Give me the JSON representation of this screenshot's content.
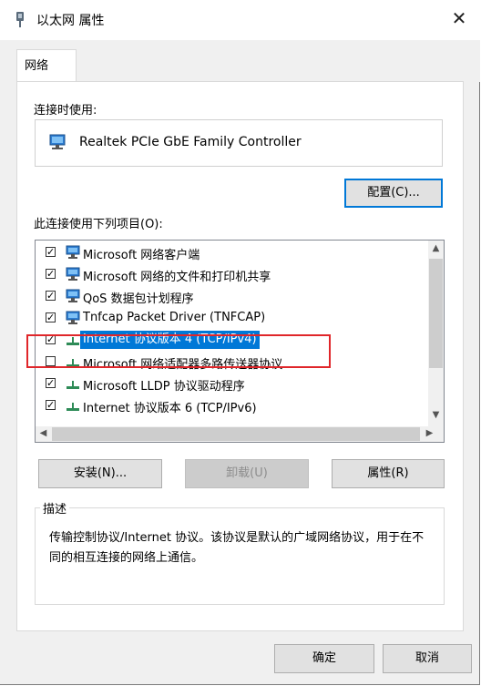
{
  "window": {
    "title": "以太网 属性",
    "close_glyph": "✕"
  },
  "tabs": [
    {
      "label": "网络"
    }
  ],
  "connect_using": {
    "label": "连接时使用:",
    "adapter": "Realtek PCIe GbE Family Controller",
    "configure_button": "配置(C)..."
  },
  "items_section": {
    "label": "此连接使用下列项目(O):",
    "items": [
      {
        "label": "Microsoft 网络客户端",
        "checked": true,
        "icon": "network-client-icon"
      },
      {
        "label": "Microsoft 网络的文件和打印机共享",
        "checked": true,
        "icon": "file-printer-sharing-icon"
      },
      {
        "label": "QoS 数据包计划程序",
        "checked": true,
        "icon": "qos-icon"
      },
      {
        "label": "Tnfcap Packet Driver (TNFCAP)",
        "checked": true,
        "icon": "packet-driver-icon"
      },
      {
        "label": "Internet 协议版本 4 (TCP/IPv4)",
        "checked": true,
        "selected": true,
        "icon": "protocol-icon"
      },
      {
        "label": "Microsoft 网络适配器多路传送器协议",
        "checked": false,
        "icon": "protocol-icon"
      },
      {
        "label": "Microsoft LLDP 协议驱动程序",
        "checked": true,
        "icon": "protocol-icon"
      },
      {
        "label": "Internet 协议版本 6 (TCP/IPv6)",
        "checked": true,
        "icon": "protocol-icon"
      }
    ]
  },
  "actions": {
    "install": "安装(N)...",
    "uninstall": "卸载(U)",
    "properties": "属性(R)"
  },
  "description": {
    "legend": "描述",
    "text": "传输控制协议/Internet 协议。该协议是默认的广域网络协议，用于在不同的相互连接的网络上通信。"
  },
  "footer": {
    "ok": "确定",
    "cancel": "取消"
  },
  "colors": {
    "selection": "#0078d7",
    "highlight_box": "#e0262a"
  }
}
